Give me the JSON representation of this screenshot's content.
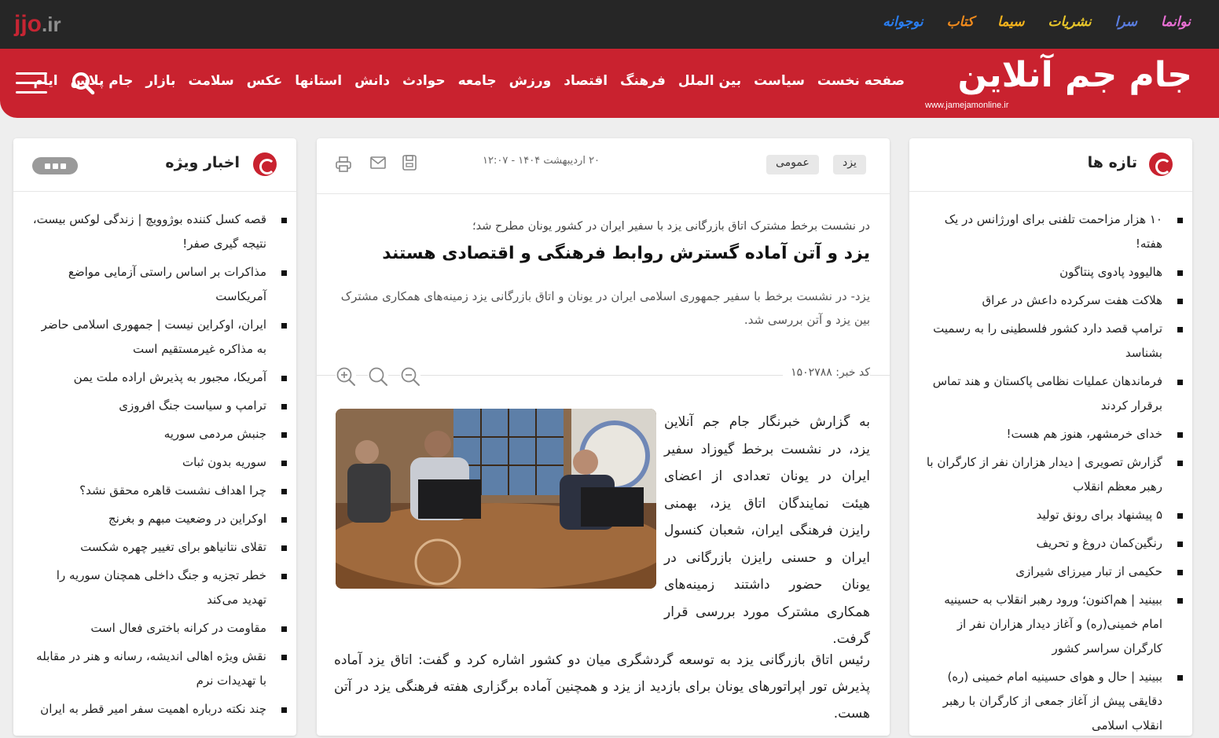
{
  "brand": {
    "jjo_main": "jjo",
    "jjo_ext": ".ir",
    "logo_text": "جام جم آنلاین",
    "logo_url": "www.jamejamonline.ir"
  },
  "sister_sites": [
    {
      "label": "نوانما",
      "color": "#e86fd3"
    },
    {
      "label": "سرا",
      "color": "#5a7de0"
    },
    {
      "label": "نشریات",
      "color": "#e6c42a"
    },
    {
      "label": "سیما",
      "color": "#f2b21c"
    },
    {
      "label": "کتاب",
      "color": "#f08a1c"
    },
    {
      "label": "نوجوانه",
      "color": "#2a7ef0"
    }
  ],
  "nav": [
    "صفحه نخست",
    "سیاست",
    "بین الملل",
    "فرهنگ",
    "اقتصاد",
    "ورزش",
    "جامعه",
    "حوادث",
    "دانش",
    "استانها",
    "عکس",
    "سلامت",
    "بازار",
    "جام پلاس",
    "ایام"
  ],
  "right_panel": {
    "title": "تازه ها",
    "items": [
      "۱۰ هزار مزاحمت تلفنی برای اورژانس در یک هفته!",
      "هالیوود پادوی پنتاگون",
      "هلاکت هفت سرکرده داعش در عراق",
      "ترامپ قصد دارد کشور فلسطینی را به رسمیت بشناسد",
      "فرماندهان عملیات نظامی پاکستان و هند تماس برقرار کردند",
      "خدای خرمشهر، هنوز هم هست!",
      "گزارش تصویری | دیدار هزاران نفر از کارگران با رهبر معظم انقلاب",
      "۵ پیشنهاد برای رونق تولید",
      "رنگین‌کمان دروغ و تحریف",
      "حکیمی از تبار میرزای شیرازی",
      "ببینید | هم‌اکنون؛ ورود رهبر انقلاب به حسینیه امام خمینی(ره) و آغاز دیدار هزاران نفر از کارگران سراسر کشور",
      "ببینید | حال و هوای حسینیه امام خمینی (ره) دقایقی پیش از آغاز جمعی از کارگران با رهبر انقلاب اسلامی"
    ]
  },
  "left_panel": {
    "title": "اخبار ویژه",
    "items": [
      "قصه کسل کننده بوژوویچ | زندگی لوکس بیست، نتیجه گیری صفر!",
      "مذاکرات بر اساس راستی آزمایی مواضع آمریکاست",
      "ایران، اوکراین نیست | جمهوری اسلامی حاضر به مذاکره غیرمستقیم است",
      "آمریکا، مجبور به پذیرش اراده ملت یمن",
      "ترامپ و سیاست جنگ افروزی",
      "جنبش مردمی سوریه",
      "سوریه بدون ثبات",
      "چرا اهداف نشست قاهره محقق نشد؟",
      "اوکراین در وضعیت مبهم و بغرنج",
      "تقلای نتانیاهو برای تغییر چهره شکست",
      "خطر تجزیه و جنگ داخلی همچنان سوریه را تهدید می‌کند",
      "مقاومت در کرانه باختری فعال است",
      "نقش ویژه اهالی اندیشه، رسانه و هنر در مقابله با تهدیدات نرم",
      "چند نکته درباره اهمیت سفر امیر قطر به ایران"
    ]
  },
  "article": {
    "tags": [
      "یزد",
      "عمومی"
    ],
    "date": "۲۰ اردیبهشت ۱۴۰۴ - ۱۲:۰۷",
    "subtitle": "در نشست برخط مشترک اتاق بازرگانی یزد با سفیر ایران در کشور یونان مطرح شد؛",
    "title": "یزد و آتن آماده گسترش روابط فرهنگی و اقتصادی هستند",
    "lead": "یزد- در نشست برخط با سفیر جمهوری اسلامی ایران در یونان و اتاق بازرگانی یزد زمینه‌های همکاری مشترک بین یزد و آتن بررسی شد.",
    "code": "کد خبر: ۱۵۰۲۷۸۸",
    "body1": "به گزارش خبرنگار جام جم آنلاین یزد، در نشست برخط گیوزاد سفیر ایران در یونان تعدادی از اعضای هیئت نمایندگان اتاق یزد، بهمنی رایزن فرهنگی ایران، شعبان کنسول ایران و حسنی رایزن بازرگانی در یونان حضور داشتند زمینه‌های همکاری مشترک مورد بررسی قرار گرفت.",
    "body2": "رئیس اتاق بازرگانی یزد به توسعه گردشگری میان دو کشور اشاره کرد و گفت: اتاق یزد آماده پذیرش تور اپراتورهای یونان برای بازدید از یزد و همچنین آماده برگزاری هفته فرهنگی یزد در آتن هست."
  }
}
